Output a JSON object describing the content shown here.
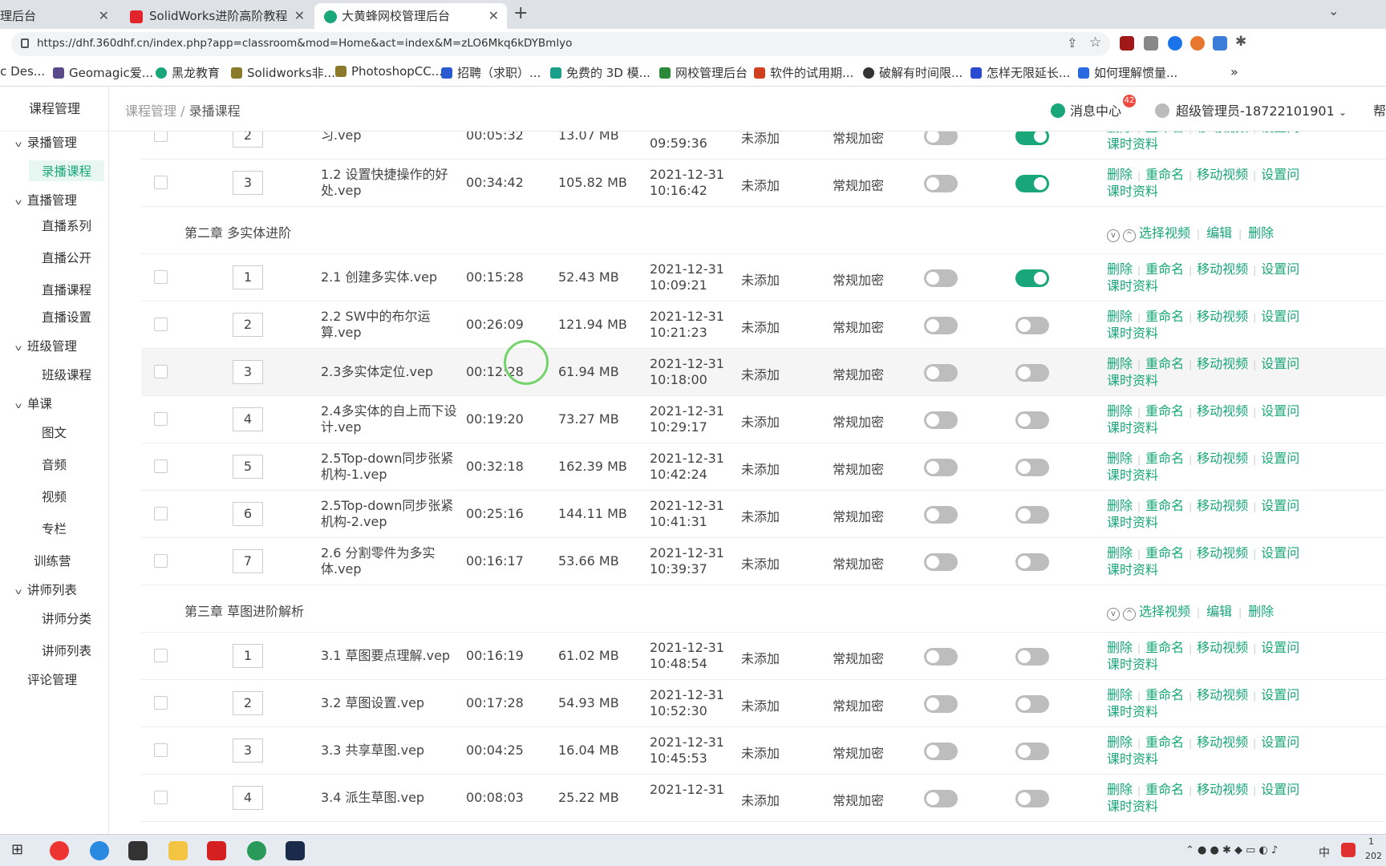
{
  "browser": {
    "tabs": [
      {
        "label": "理后台",
        "active": false
      },
      {
        "label": "SolidWorks进阶高阶教程",
        "active": false
      },
      {
        "label": "大黄蜂网校管理后台",
        "active": true
      }
    ],
    "url": "https://dhf.360dhf.cn/index.php?app=classroom&mod=Home&act=index&M=zLO6Mkq6kDYBmlyo",
    "bookmarks": [
      "ic Des...",
      "Geomagic爱...",
      "黑龙教育",
      "Solidworks非...",
      "PhotoshopCC...",
      "招聘（求职）...",
      "免费的 3D 模...",
      "网校管理后台",
      "软件的试用期...",
      "破解有时间限...",
      "怎样无限延长...",
      "如何理解惯量..."
    ]
  },
  "sidebar": {
    "title": "课程管理",
    "groups": [
      {
        "label": "录播管理",
        "items": [
          "录播课程"
        ]
      },
      {
        "label": "直播管理",
        "items": [
          "直播系列",
          "直播公开",
          "直播课程",
          "直播设置"
        ]
      },
      {
        "label": "班级管理",
        "items": [
          "班级课程"
        ]
      },
      {
        "label": "单课",
        "items": [
          "图文",
          "音频",
          "视频",
          "专栏"
        ]
      }
    ],
    "training": "训练营",
    "teacher_group": "讲师列表",
    "teacher_items": [
      "讲师分类",
      "讲师列表"
    ],
    "comments": "评论管理"
  },
  "header": {
    "breadcrumb_root": "课程管理",
    "breadcrumb_sep": "/",
    "breadcrumb_current": "录播课程",
    "message_center": "消息中心",
    "message_badge": "42",
    "user": "超级管理员-18722101901",
    "help": "帮"
  },
  "ops": {
    "delete": "删除",
    "rename": "重命名",
    "move": "移动视频",
    "set": "设置问",
    "materials": "课时资料"
  },
  "chapter_ops": {
    "select": "选择视频",
    "edit": "编辑",
    "delete": "删除"
  },
  "rows": [
    {
      "kind": "row",
      "num": "2",
      "name": "习.vep",
      "duration": "00:05:32",
      "size": "13.07 MB",
      "date": "",
      "time": "09:59:36",
      "status": "未添加",
      "enc": "常规加密",
      "t1": false,
      "t2": true
    },
    {
      "kind": "row",
      "num": "3",
      "name": "1.2 设置快捷操作的好处.vep",
      "duration": "00:34:42",
      "size": "105.82 MB",
      "date": "2021-12-31",
      "time": "10:16:42",
      "status": "未添加",
      "enc": "常规加密",
      "t1": false,
      "t2": true
    },
    {
      "kind": "chapter",
      "title": "第二章 多实体进阶"
    },
    {
      "kind": "row",
      "num": "1",
      "name": "2.1 创建多实体.vep",
      "duration": "00:15:28",
      "size": "52.43 MB",
      "date": "2021-12-31",
      "time": "10:09:21",
      "status": "未添加",
      "enc": "常规加密",
      "t1": false,
      "t2": true
    },
    {
      "kind": "row",
      "num": "2",
      "name": "2.2 SW中的布尔运算.vep",
      "duration": "00:26:09",
      "size": "121.94 MB",
      "date": "2021-12-31",
      "time": "10:21:23",
      "status": "未添加",
      "enc": "常规加密",
      "t1": false,
      "t2": false
    },
    {
      "kind": "row",
      "num": "3",
      "name": "2.3多实体定位.vep",
      "duration": "00:12:28",
      "size": "61.94 MB",
      "date": "2021-12-31",
      "time": "10:18:00",
      "status": "未添加",
      "enc": "常规加密",
      "t1": false,
      "t2": false,
      "hl": true
    },
    {
      "kind": "row",
      "num": "4",
      "name": "2.4多实体的自上而下设计.vep",
      "duration": "00:19:20",
      "size": "73.27 MB",
      "date": "2021-12-31",
      "time": "10:29:17",
      "status": "未添加",
      "enc": "常规加密",
      "t1": false,
      "t2": false
    },
    {
      "kind": "row",
      "num": "5",
      "name": "2.5Top-down同步张紧机构-1.vep",
      "duration": "00:32:18",
      "size": "162.39 MB",
      "date": "2021-12-31",
      "time": "10:42:24",
      "status": "未添加",
      "enc": "常规加密",
      "t1": false,
      "t2": false
    },
    {
      "kind": "row",
      "num": "6",
      "name": "2.5Top-down同步张紧机构-2.vep",
      "duration": "00:25:16",
      "size": "144.11 MB",
      "date": "2021-12-31",
      "time": "10:41:31",
      "status": "未添加",
      "enc": "常规加密",
      "t1": false,
      "t2": false
    },
    {
      "kind": "row",
      "num": "7",
      "name": "2.6 分割零件为多实体.vep",
      "duration": "00:16:17",
      "size": "53.66 MB",
      "date": "2021-12-31",
      "time": "10:39:37",
      "status": "未添加",
      "enc": "常规加密",
      "t1": false,
      "t2": false
    },
    {
      "kind": "chapter",
      "title": "第三章 草图进阶解析"
    },
    {
      "kind": "row",
      "num": "1",
      "name": "3.1 草图要点理解.vep",
      "duration": "00:16:19",
      "size": "61.02 MB",
      "date": "2021-12-31",
      "time": "10:48:54",
      "status": "未添加",
      "enc": "常规加密",
      "t1": false,
      "t2": false
    },
    {
      "kind": "row",
      "num": "2",
      "name": "3.2 草图设置.vep",
      "duration": "00:17:28",
      "size": "54.93 MB",
      "date": "2021-12-31",
      "time": "10:52:30",
      "status": "未添加",
      "enc": "常规加密",
      "t1": false,
      "t2": false
    },
    {
      "kind": "row",
      "num": "3",
      "name": "3.3 共享草图.vep",
      "duration": "00:04:25",
      "size": "16.04 MB",
      "date": "2021-12-31",
      "time": "10:45:53",
      "status": "未添加",
      "enc": "常规加密",
      "t1": false,
      "t2": false
    },
    {
      "kind": "row",
      "num": "4",
      "name": "3.4 派生草图.vep",
      "duration": "00:08:03",
      "size": "25.22 MB",
      "date": "2021-12-31",
      "time": "",
      "status": "未添加",
      "enc": "常规加密",
      "t1": false,
      "t2": false
    }
  ],
  "taskbar": {
    "tray_lang": "中",
    "clock_top": "1",
    "clock_bottom": "202"
  },
  "colors": {
    "accent": "#19a77a",
    "badge": "#f04a3e",
    "toggle_off": "#bdbdbd"
  }
}
